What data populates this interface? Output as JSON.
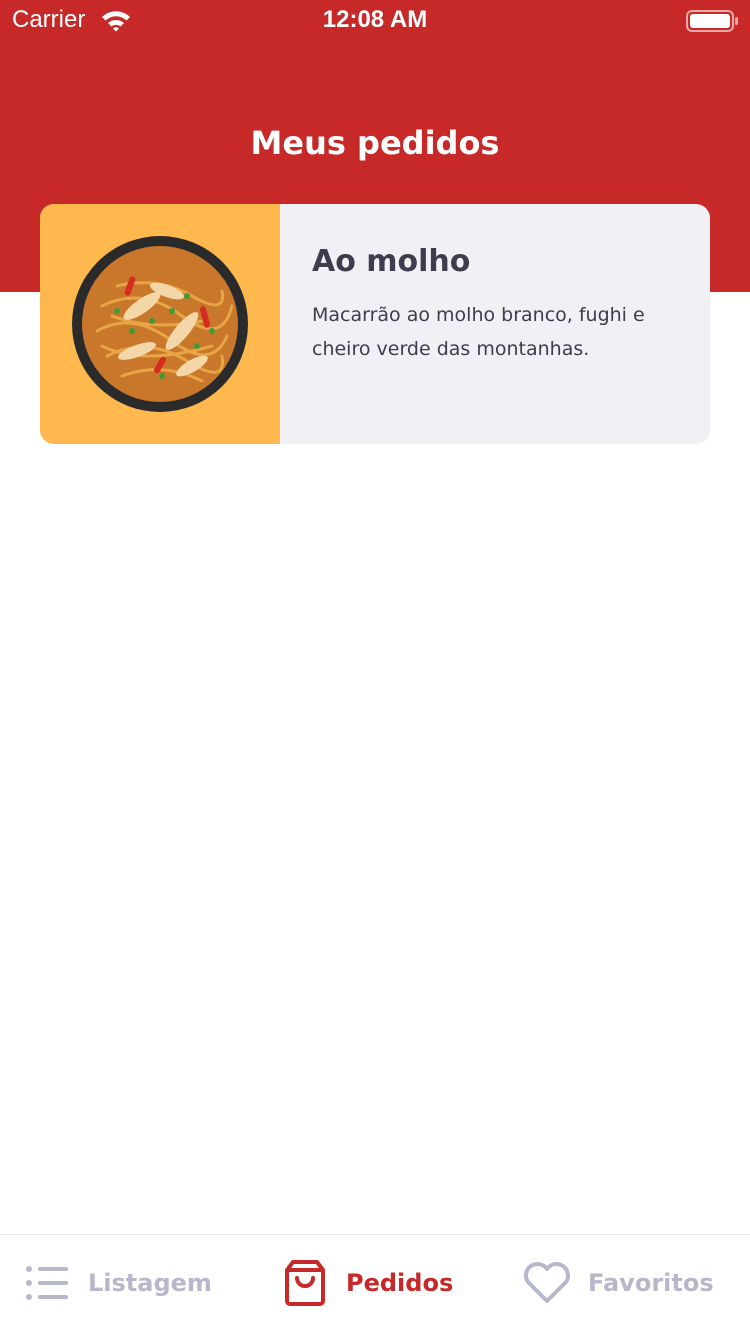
{
  "status_bar": {
    "carrier": "Carrier",
    "time": "12:08 AM"
  },
  "header": {
    "title": "Meus pedidos",
    "background_color": "#c72828"
  },
  "orders": [
    {
      "name": "Ao molho",
      "description": "Macarrão ao molho branco, fughi e cheiro verde das montanhas.",
      "image_icon": "pasta-dish-image",
      "image_background": "#ffb84d"
    }
  ],
  "tab_bar": {
    "active_tab": "Pedidos",
    "active_color": "#c72828",
    "inactive_color": "#b7b7cc",
    "tabs": [
      {
        "label": "Listagem",
        "icon": "list-icon"
      },
      {
        "label": "Pedidos",
        "icon": "shopping-bag-icon"
      },
      {
        "label": "Favoritos",
        "icon": "heart-icon"
      }
    ]
  }
}
